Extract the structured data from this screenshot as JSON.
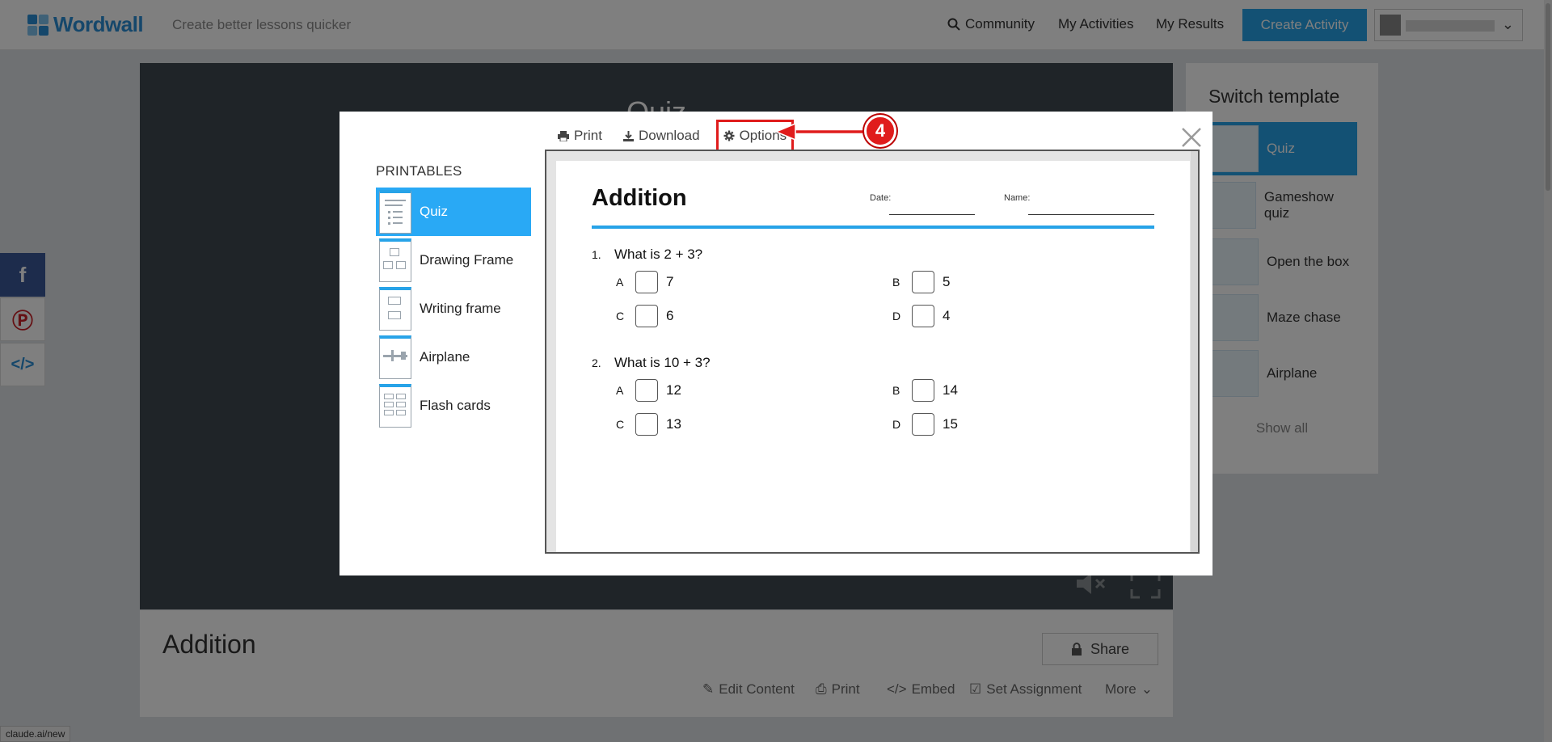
{
  "header": {
    "logo_text": "Wordwall",
    "tagline": "Create better lessons quicker",
    "nav": {
      "community": "Community",
      "my_activities": "My Activities",
      "my_results": "My Results"
    },
    "create_activity": "Create Activity"
  },
  "game": {
    "title": "Quiz"
  },
  "activity": {
    "title": "Addition",
    "share_label": "Share",
    "actions": [
      "Edit Content",
      "Print",
      "Embed",
      "Set Assignment",
      "More"
    ]
  },
  "side_panel": {
    "title": "Switch template",
    "templates": [
      "Quiz",
      "Gameshow quiz",
      "Open the box",
      "Maze chase",
      "Airplane"
    ],
    "show_all": "Show all"
  },
  "modal": {
    "toolbar": {
      "print": "Print",
      "download": "Download",
      "options": "Options"
    },
    "printables_heading": "PRINTABLES",
    "printables": [
      "Quiz",
      "Drawing Frame",
      "Writing frame",
      "Airplane",
      "Flash cards"
    ],
    "selected_printable": "Quiz",
    "worksheet": {
      "title": "Addition",
      "date_label": "Date:",
      "name_label": "Name:",
      "questions": [
        {
          "number": "1.",
          "text": "What is 2 + 3?",
          "options": [
            {
              "letter": "A",
              "value": "7"
            },
            {
              "letter": "B",
              "value": "5"
            },
            {
              "letter": "C",
              "value": "6"
            },
            {
              "letter": "D",
              "value": "4"
            }
          ]
        },
        {
          "number": "2.",
          "text": "What is 10 + 3?",
          "options": [
            {
              "letter": "A",
              "value": "12"
            },
            {
              "letter": "B",
              "value": "14"
            },
            {
              "letter": "C",
              "value": "13"
            },
            {
              "letter": "D",
              "value": "15"
            }
          ]
        }
      ]
    }
  },
  "annotation": {
    "step_number": "4",
    "color": "#e01c1c"
  },
  "status_bar": {
    "url": "claude.ai/new"
  },
  "colors": {
    "brand_blue": "#27a3e8",
    "selected_item": "#29a9f5",
    "facebook": "#3b5998",
    "pinterest": "#cb2027"
  }
}
